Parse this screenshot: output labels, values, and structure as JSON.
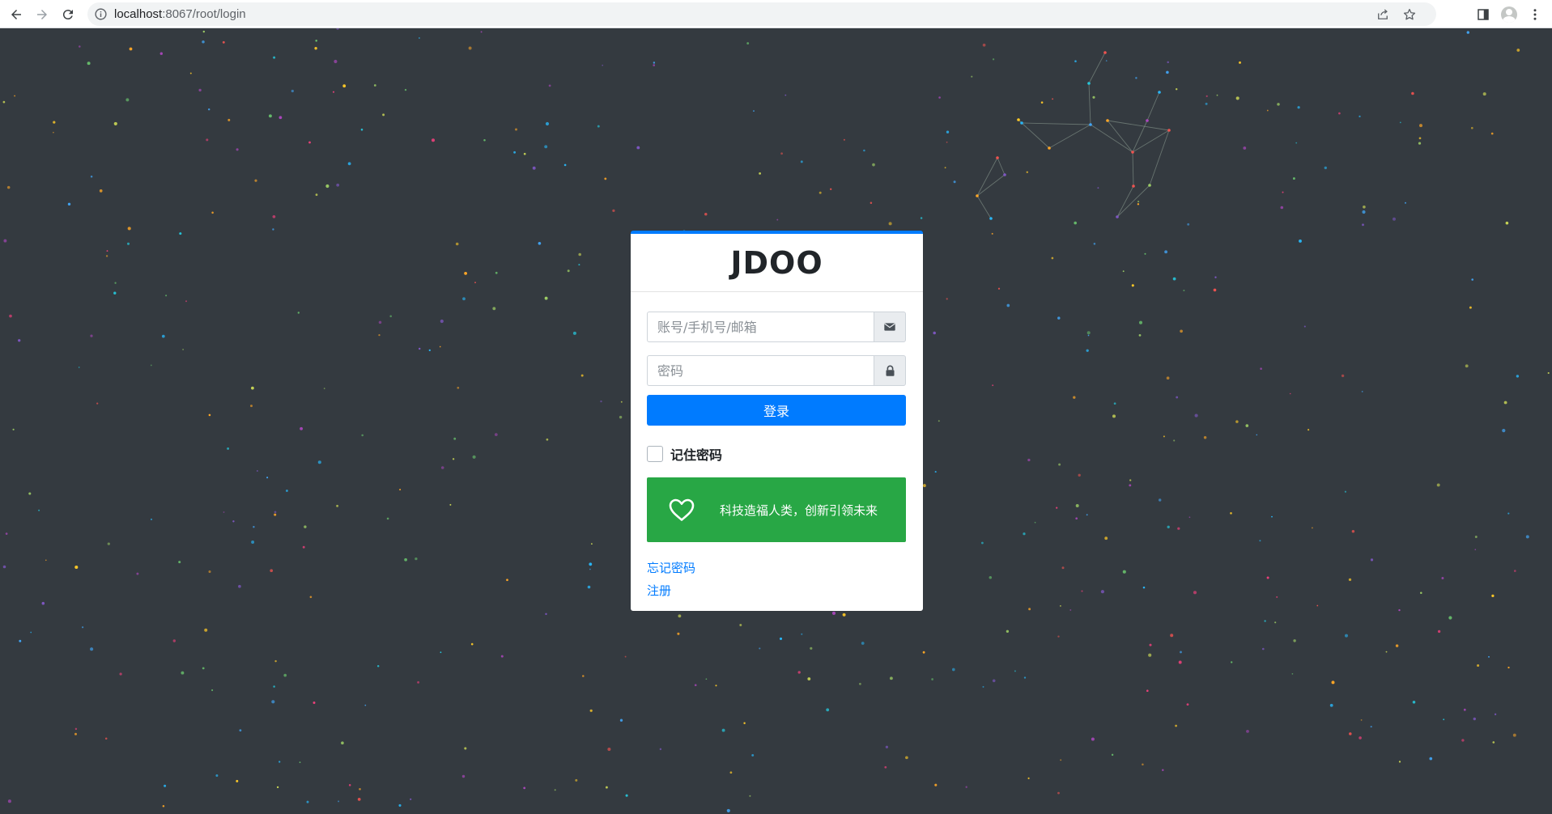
{
  "browser": {
    "url_host": "localhost",
    "url_rest": ":8067/root/login",
    "icons": [
      "back-arrow-icon",
      "forward-arrow-icon",
      "reload-icon",
      "info-icon",
      "share-icon",
      "star-icon",
      "side-panel-icon",
      "profile-avatar",
      "more-vert-icon"
    ]
  },
  "login": {
    "brand": "JDOO",
    "account_placeholder": "账号/手机号/邮箱",
    "account_value": "",
    "password_placeholder": "密码",
    "password_value": "",
    "submit_label": "登录",
    "remember_label": "记住密码",
    "remember_checked": false,
    "slogan": "科技造福人类，创新引领未来",
    "forgot_link": "忘记密码",
    "register_link": "注册"
  },
  "colors": {
    "background": "#343a40",
    "primary": "#007bff",
    "success": "#28a745",
    "card": "#ffffff"
  }
}
